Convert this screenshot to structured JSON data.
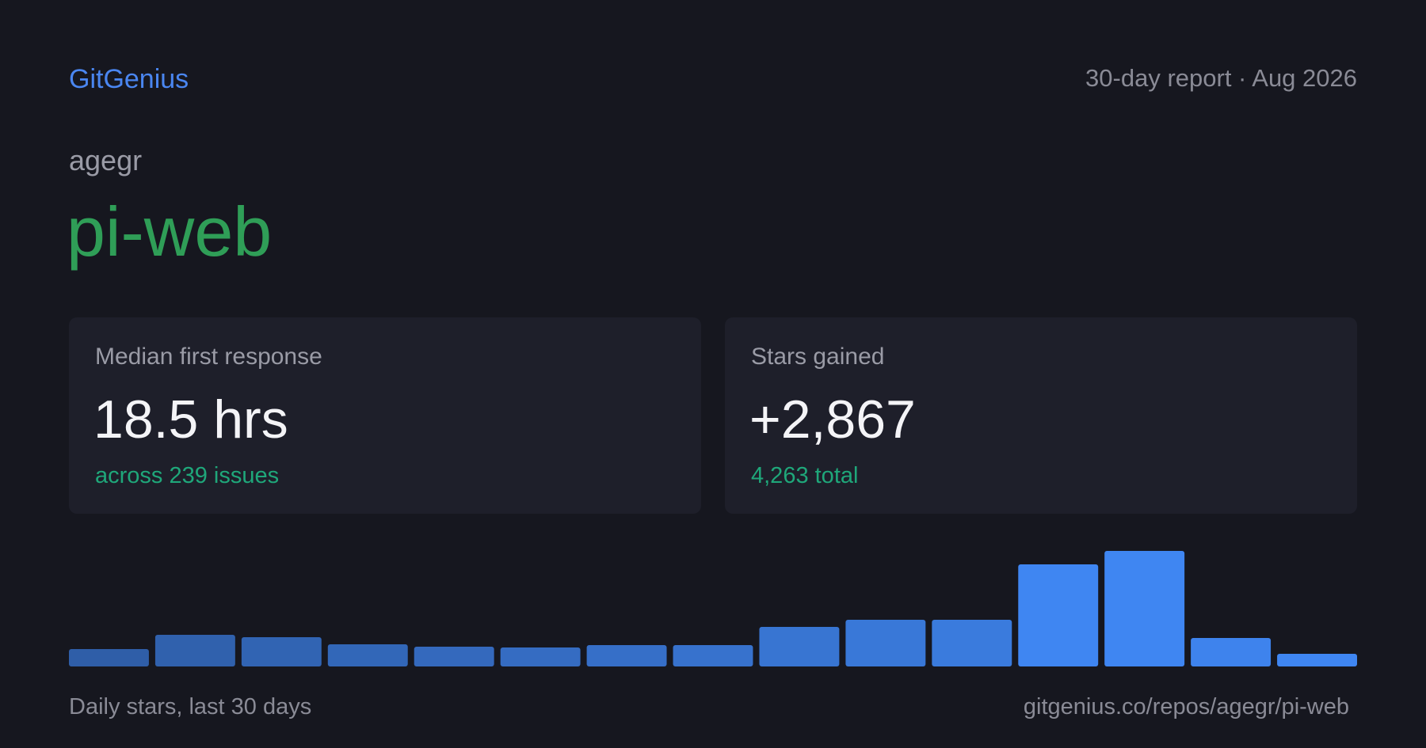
{
  "header": {
    "brand": "GitGenius",
    "report_label": "30-day report · Aug 2026"
  },
  "repo": {
    "owner": "agegr",
    "name": "pi-web"
  },
  "stats": [
    {
      "label": "Median first response",
      "value": "18.5 hrs",
      "sub": "across 239 issues"
    },
    {
      "label": "Stars gained",
      "value": "+2,867",
      "sub": "4,263 total"
    }
  ],
  "colors": {
    "background": "#16171f",
    "card": "#1e1f2a",
    "brand": "#4a86f0",
    "repo_name": "#2f9e57",
    "positive": "#1fa77a",
    "bar_low": "#2f5ea8",
    "bar_high": "#3f86f2"
  },
  "chart_data": {
    "type": "bar",
    "values": [
      22,
      40,
      37,
      28,
      25,
      24,
      27,
      27,
      50,
      59,
      59,
      129,
      146,
      36,
      16
    ],
    "ylim": [
      0,
      150
    ]
  },
  "footer": {
    "caption": "Daily stars, last 30 days",
    "url": "gitgenius.co/repos/agegr/pi-web"
  }
}
